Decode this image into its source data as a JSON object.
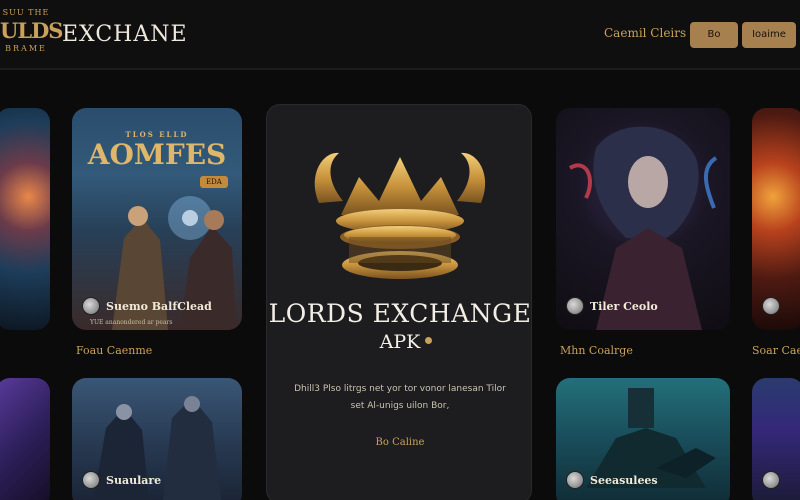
{
  "header": {
    "logo_top": "SUU THE",
    "logo_main": "ULDS",
    "logo_bottom": "BRAME",
    "brand": "EXCHANE",
    "nav_link": "Caemil Cleirs",
    "btn_1": "Bo",
    "btn_2": "Ioaime"
  },
  "cards": [
    {
      "id": "a",
      "caption": "",
      "sub": "",
      "below": ""
    },
    {
      "id": "b",
      "title": "AOMFES",
      "title_top": "TLOS ELLD",
      "badge": "EDA",
      "caption": "Suemo BalfClead",
      "sub": "YUE ananondered ar pears",
      "below": "Foau Caenme"
    },
    {
      "id": "c",
      "caption": "Tiler Ceolo",
      "sub": "",
      "below": "Mhn Coalrge"
    },
    {
      "id": "d",
      "caption": "",
      "sub": "",
      "below": "Soar Cae"
    },
    {
      "id": "e",
      "caption": "",
      "sub": "",
      "below": ""
    },
    {
      "id": "f",
      "caption": "Suaulare",
      "sub": "",
      "below": ""
    },
    {
      "id": "g",
      "caption": "Seeasulees",
      "sub": "",
      "below": ""
    },
    {
      "id": "h",
      "caption": "",
      "sub": "",
      "below": ""
    }
  ],
  "feature": {
    "title": "LORDS EXCHANGE",
    "subtitle": "APK",
    "desc_line1": "Dhill3 Plso litrgs net yor tor vonor lanesan Tilor",
    "desc_line2": "set Al-unigs uilon Bor,",
    "cta": "Bo Caline"
  },
  "colors": {
    "accent_gold": "#c9a15a",
    "button_bg": "#a7804f",
    "background": "#0b0b0c",
    "panel": "#1d1d20"
  }
}
